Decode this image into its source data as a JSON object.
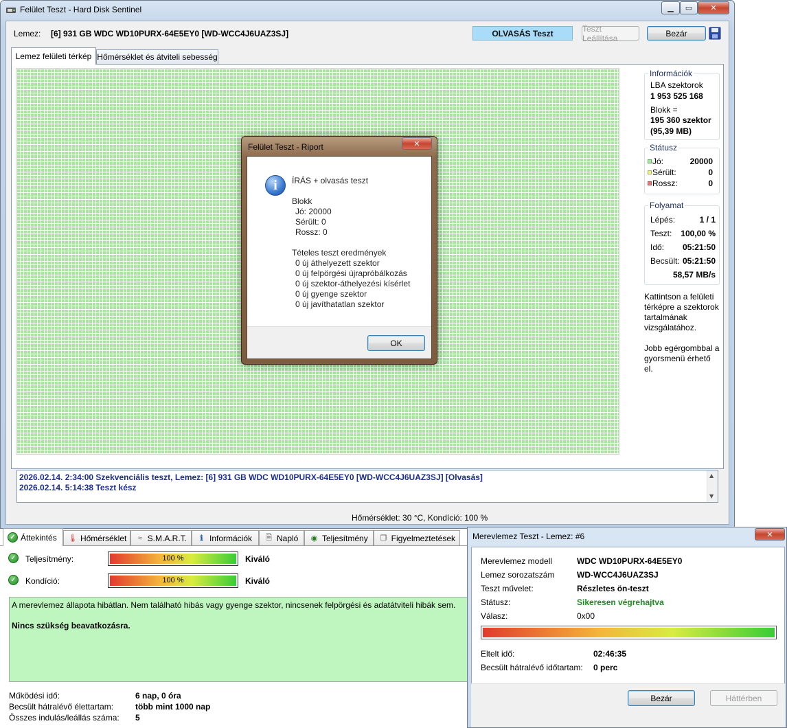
{
  "main_window": {
    "title": "Felület Teszt - Hard Disk Sentinel",
    "disk_label": "Lemez:",
    "disk_value": "[6] 931 GB  WDC WD10PURX-64E5EY0 [WD-WCC4J6UAZ3SJ]",
    "test_mode": "OLVASÁS Teszt",
    "stop_button": "Teszt Leállítása",
    "close_button": "Bezár",
    "tabs": [
      "Lemez felületi térkép",
      "Hőmérséklet és átviteli sebesség"
    ],
    "info": {
      "title": "Információk",
      "lba_label": "LBA szektorok",
      "lba_value": "1 953 525 168",
      "block_label": "Blokk =",
      "block_value": "195 360 szektor",
      "block_size": "(95,39 MB)"
    },
    "status": {
      "title": "Státusz",
      "good_label": "Jó:",
      "good_value": "20000",
      "damaged_label": "Sérült:",
      "damaged_value": "0",
      "bad_label": "Rossz:",
      "bad_value": "0"
    },
    "progress": {
      "title": "Folyamat",
      "step_label": "Lépés:",
      "step_value": "1 / 1",
      "test_label": "Teszt:",
      "test_value": "100,00 %",
      "time_label": "Idő:",
      "time_value": "05:21:50",
      "est_label": "Becsült:",
      "est_value": "05:21:50",
      "speed": "58,57 MB/s"
    },
    "hint1": [
      "Kattintson a felületi",
      "térképre a szektorok",
      "tartalmának",
      "vizsgálatához."
    ],
    "hint2": [
      "Jobb egérgombbal a",
      "gyorsmenü érhető",
      "el."
    ],
    "log": [
      "2026.02.14.  2:34:00   Szekvenciális teszt, Lemez: [6] 931 GB  WDC WD10PURX-64E5EY0 [WD-WCC4J6UAZ3SJ] [Olvasás]",
      "2026.02.14.  5:14:38   Teszt kész"
    ],
    "statusbar": "Hőmérséklet: 30  °C,  Kondíció: 100 %"
  },
  "report_dialog": {
    "title": "Felület Teszt - Riport",
    "heading": "ÍRÁS + olvasás teszt",
    "block_title": "Blokk",
    "block_lines": [
      "Jó: 20000",
      "Sérült: 0",
      "Rossz: 0"
    ],
    "results_title": "Tételes teszt eredmények",
    "result_lines": [
      "0 új áthelyezett szektor",
      "0 új felpörgési újrapróbálkozás",
      "0 új szektor-áthelyezési kísérlet",
      "0 új gyenge szektor",
      "0 új javíthatatlan szektor"
    ],
    "ok": "OK"
  },
  "overview": {
    "tabs": [
      "Áttekintés",
      "Hőmérséklet",
      "S.M.A.R.T.",
      "Információk",
      "Napló",
      "Teljesítmény",
      "Figyelmeztetések"
    ],
    "performance_label": "Teljesítmény:",
    "performance_value": "100 %",
    "performance_fraction": 1.0,
    "performance_rating": "Kiváló",
    "condition_label": "Kondíció:",
    "condition_value": "100 %",
    "condition_fraction": 1.0,
    "condition_rating": "Kiváló",
    "summary": "A merevlemez állapota hibátlan. Nem található hibás vagy gyenge szektor, nincsenek felpörgési és adatátviteli hibák sem.",
    "summary_bold": "Nincs szükség beavatkozásra.",
    "uptime_label": "Működési idő:",
    "uptime_value": "6 nap, 0 óra",
    "lifetime_label": "Becsült hátralévő élettartam:",
    "lifetime_value": "több mint 1000 nap",
    "starts_label": "Összes indulás/leállás száma:",
    "starts_value": "5"
  },
  "test_dialog": {
    "title": "Merevlemez Teszt - Lemez: #6",
    "model_label": "Merevlemez modell",
    "model_value": "WDC WD10PURX-64E5EY0",
    "serial_label": "Lemez sorozatszám",
    "serial_value": "WD-WCC4J6UAZ3SJ",
    "op_label": "Teszt művelet:",
    "op_value": "Részletes ön-teszt",
    "status_label": "Státusz:",
    "status_value": "Sikeresen végrehajtva",
    "response_label": "Válasz:",
    "response_value": "0x00",
    "progress_fraction": 1.0,
    "elapsed_label": "Eltelt idő:",
    "elapsed_value": "02:46:35",
    "remaining_label": "Becsült hátralévő időtartam:",
    "remaining_value": "0 perc",
    "close_button": "Bezár",
    "background_button": "Háttérben"
  },
  "colors": {
    "good": "#a8e6a0",
    "damaged": "#f0f080",
    "bad": "#e87a7a",
    "log_text": "#1b2d8f",
    "status_success": "#1e8a1e"
  }
}
